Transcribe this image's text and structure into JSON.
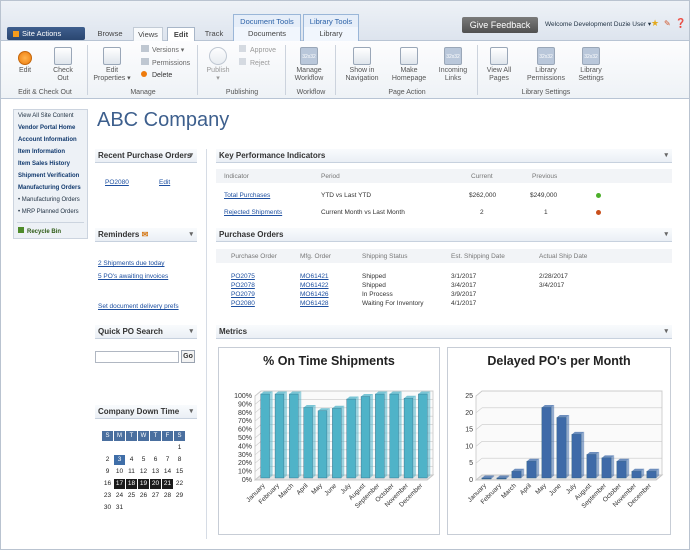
{
  "topbar": {
    "site_actions": "Site Actions",
    "tabs": [
      "Browse",
      "Views",
      "Edit",
      "Track"
    ],
    "ctx_groups": [
      "Document Tools",
      "Library Tools"
    ],
    "ctx_tabs": [
      "Documents",
      "Library"
    ],
    "give_feedback": "Give Feedback",
    "welcome": "Welcome Development Duzie User ▾"
  },
  "ribbon": {
    "buttons": [
      {
        "label": "Edit",
        "sub": ""
      },
      {
        "label": "Check",
        "sub": "Out"
      },
      {
        "label": "Edit",
        "sub": "Properties ▾"
      },
      {
        "label": "Publish",
        "sub": ""
      },
      {
        "label": "Manage",
        "sub": "Workflow"
      },
      {
        "label": "Show in",
        "sub": "Navigation"
      },
      {
        "label": "Make",
        "sub": "Homepage"
      },
      {
        "label": "Incoming",
        "sub": "Links"
      },
      {
        "label": "View All",
        "sub": "Pages"
      },
      {
        "label": "Library",
        "sub": "Permissions"
      },
      {
        "label": "Library",
        "sub": "Settings"
      }
    ],
    "small_buttons": [
      "Versions ▾",
      "Permissions",
      "Delete",
      "Approve",
      "Reject"
    ],
    "groups": [
      "Edit & Check Out",
      "Manage",
      "Publishing",
      "Workflow",
      "Page Action",
      "Library Settings"
    ],
    "icon_placeholders": [
      "32x32",
      "32x32",
      "32x32",
      "32x32",
      "32x32"
    ]
  },
  "leftnav": {
    "items": [
      "View All Site Content",
      "Vendor Portal Home",
      "Account Information",
      "Item Information",
      "Item Sales History",
      "Shipment Verification",
      "Manufacturing Orders",
      "• Manufacturing Orders",
      "• MRP Planned Orders"
    ],
    "recycle": "Recycle Bin"
  },
  "page_title": "ABC Company",
  "recent_po": {
    "title": "Recent Purchase Orders",
    "po": "PO2080",
    "action": "Edit"
  },
  "reminders": {
    "title": "Reminders",
    "items": [
      "2 Shipments due today",
      "5 PO's awaiting invoices",
      "Set document delivery prefs"
    ]
  },
  "quick_po": {
    "title": "Quick PO Search",
    "go": "Go"
  },
  "downtime": {
    "title": "Company Down Time",
    "days": [
      "S",
      "M",
      "T",
      "W",
      "T",
      "F",
      "S"
    ],
    "rows": [
      [
        "",
        "",
        "",
        "",
        "",
        "",
        "1"
      ],
      [
        "2",
        "3",
        "4",
        "5",
        "6",
        "7",
        "8"
      ],
      [
        "9",
        "10",
        "11",
        "12",
        "13",
        "14",
        "15"
      ],
      [
        "16",
        "17",
        "18",
        "19",
        "20",
        "21",
        "22"
      ],
      [
        "23",
        "24",
        "25",
        "26",
        "27",
        "28",
        "29"
      ],
      [
        "30",
        "31",
        "",
        "",
        "",
        "",
        ""
      ]
    ]
  },
  "kpi": {
    "title": "Key Performance Indicators",
    "headers": [
      "Indicator",
      "Period",
      "Current",
      "Previous"
    ],
    "rows": [
      {
        "indicator": "Total Purchases",
        "period": "YTD vs Last YTD",
        "current": "$262,000",
        "previous": "$249,000",
        "status": "#4caf2a"
      },
      {
        "indicator": "Rejected Shipments",
        "period": "Current Month vs Last Month",
        "current": "2",
        "previous": "1",
        "status": "#c9501c"
      }
    ]
  },
  "purchase_orders": {
    "title": "Purchase Orders",
    "headers": [
      "Purchase Order",
      "Mfg. Order",
      "Shipping Status",
      "Est. Shipping Date",
      "Actual Ship Date"
    ],
    "rows": [
      [
        "PO2075",
        "MO61421",
        "Shipped",
        "3/1/2017",
        "2/28/2017"
      ],
      [
        "PO2078",
        "MO61422",
        "Shipped",
        "3/4/2017",
        "3/4/2017"
      ],
      [
        "PO2079",
        "MO61426",
        "In Process",
        "3/9/2017",
        ""
      ],
      [
        "PO2080",
        "MO61428",
        "Waiting For Inventory",
        "4/1/2017",
        ""
      ]
    ]
  },
  "metrics": {
    "title": "Metrics"
  },
  "chart_data": [
    {
      "type": "bar",
      "title": "% On Time Shipments",
      "categories": [
        "January",
        "February",
        "March",
        "April",
        "May",
        "June",
        "July",
        "August",
        "September",
        "October",
        "November",
        "December"
      ],
      "values": [
        100,
        100,
        100,
        84,
        80,
        83,
        94,
        97,
        100,
        100,
        95,
        100
      ],
      "ylim": [
        0,
        100
      ],
      "yticks": [
        "0%",
        "10%",
        "20%",
        "30%",
        "40%",
        "50%",
        "60%",
        "70%",
        "80%",
        "90%",
        "100%"
      ],
      "color": "#4fb3c8"
    },
    {
      "type": "bar",
      "title": "Delayed PO's per Month",
      "categories": [
        "January",
        "February",
        "March",
        "April",
        "May",
        "June",
        "July",
        "August",
        "September",
        "October",
        "November",
        "December"
      ],
      "values": [
        0,
        0,
        2,
        5,
        21,
        18,
        13,
        7,
        6,
        5,
        2,
        2
      ],
      "ylim": [
        0,
        25
      ],
      "yticks": [
        "0",
        "5",
        "10",
        "15",
        "20",
        "25"
      ],
      "color": "#3e6aa8"
    }
  ]
}
